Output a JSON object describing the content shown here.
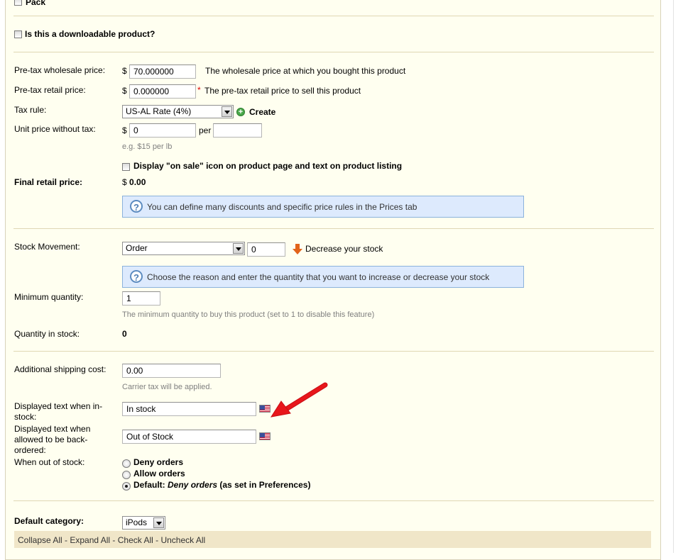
{
  "pack": {
    "label": "Pack"
  },
  "downloadable": {
    "label": "Is this a downloadable product?"
  },
  "prices": {
    "wholesale": {
      "label": "Pre-tax wholesale price:",
      "currency": "$",
      "value": "70.000000",
      "desc": "The wholesale price at which you bought this product"
    },
    "retail": {
      "label": "Pre-tax retail price:",
      "currency": "$",
      "value": "0.000000",
      "required": "*",
      "desc": "The pre-tax retail price to sell this product"
    },
    "tax_rule": {
      "label": "Tax rule:",
      "selected": "US-AL Rate (4%)",
      "create_label": "Create"
    },
    "unit_price": {
      "label": "Unit price without tax:",
      "currency": "$",
      "value": "0",
      "per_label": "per",
      "per_value": "",
      "hint": "e.g. $15 per lb"
    },
    "on_sale": {
      "label": "Display \"on sale\" icon on product page and text on product listing"
    },
    "final": {
      "label": "Final retail price:",
      "currency": "$",
      "value": "0.00"
    },
    "info": "You can define many discounts and specific price rules in the Prices tab"
  },
  "stock": {
    "movement": {
      "label": "Stock Movement:",
      "selected": "Order",
      "quantity": "0",
      "action": "Decrease your stock"
    },
    "info": "Choose the reason and enter the quantity that you want to increase or decrease your stock",
    "min_qty": {
      "label": "Minimum quantity:",
      "value": "1",
      "hint": "The minimum quantity to buy this product (set to 1 to disable this feature)"
    },
    "in_stock": {
      "label": "Quantity in stock:",
      "value": "0"
    }
  },
  "shipping": {
    "additional": {
      "label": "Additional shipping cost:",
      "value": "0.00",
      "hint": "Carrier tax will be applied."
    },
    "text_in_stock": {
      "label_line1": "Displayed text when in-",
      "label_line2": "stock:",
      "value": "In stock"
    },
    "text_backorder": {
      "label_line1": "Displayed text when",
      "label_line2": "allowed to be back-",
      "label_line3": "ordered:",
      "value": "Out of Stock"
    },
    "out_of_stock": {
      "label": "When out of stock:",
      "deny": "Deny orders",
      "allow": "Allow orders",
      "default_prefix": "Default:",
      "default_value": "Deny orders",
      "default_suffix": "(as set in Preferences)"
    }
  },
  "category": {
    "label": "Default category:",
    "selected": "iPods",
    "collapse": "Collapse All",
    "expand": "Expand All",
    "check": "Check All",
    "uncheck": "Uncheck All",
    "sep": " - "
  },
  "colors": {
    "arrow": "#e8161b",
    "info_bg": "#ddeafd",
    "panel_bg": "#fffff0"
  },
  "icons": {
    "flag": "us-flag-icon",
    "create": "add-circle-icon",
    "decrease": "arrow-down-icon",
    "help": "question-icon"
  }
}
